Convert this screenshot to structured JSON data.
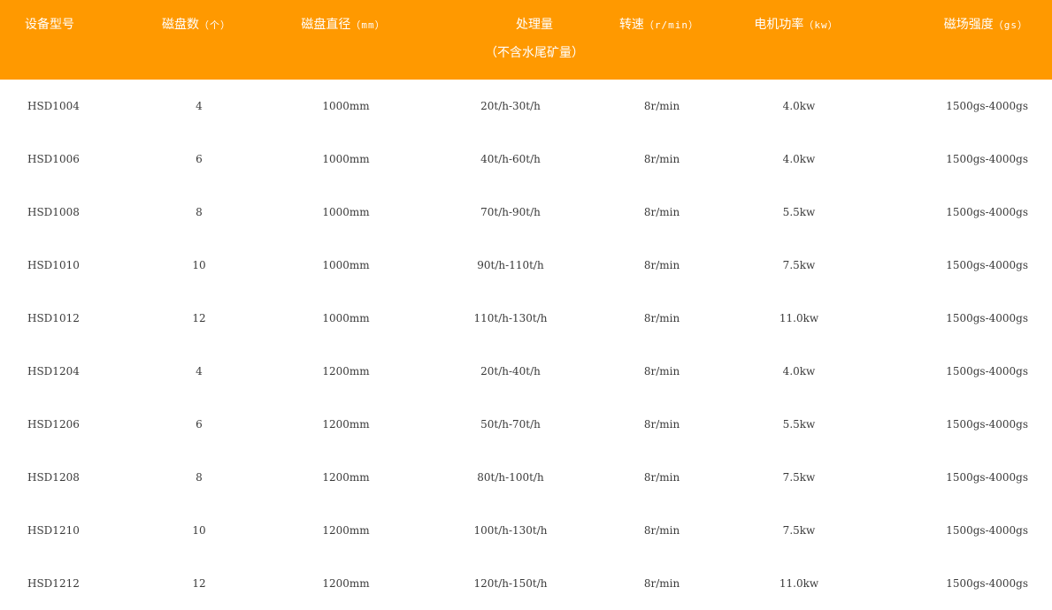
{
  "colors": {
    "header_background": "#ff9900",
    "header_text": "#ffffff",
    "body_text": "#3a3a3a",
    "page_background": "#ffffff"
  },
  "headers": {
    "model": "设备型号",
    "disc_count": "磁盘数",
    "disc_count_unit": "（个）",
    "disc_diameter": "磁盘直径",
    "disc_diameter_unit": "（mm）",
    "capacity": "处理量",
    "capacity_note": "（不含水尾矿量）",
    "speed": "转速",
    "speed_unit": "（r/min）",
    "motor_power": "电机功率",
    "motor_power_unit": "（kw）",
    "field_strength": "磁场强度",
    "field_strength_unit": "（gs）"
  },
  "rows": [
    {
      "model": "HSD1004",
      "disc_count": "4",
      "disc_diameter": "1000mm",
      "capacity": "20t/h-30t/h",
      "speed": "8r/min",
      "motor_power": "4.0kw",
      "field_strength": "1500gs-4000gs"
    },
    {
      "model": "HSD1006",
      "disc_count": "6",
      "disc_diameter": "1000mm",
      "capacity": "40t/h-60t/h",
      "speed": "8r/min",
      "motor_power": "4.0kw",
      "field_strength": "1500gs-4000gs"
    },
    {
      "model": "HSD1008",
      "disc_count": "8",
      "disc_diameter": "1000mm",
      "capacity": "70t/h-90t/h",
      "speed": "8r/min",
      "motor_power": "5.5kw",
      "field_strength": "1500gs-4000gs"
    },
    {
      "model": "HSD1010",
      "disc_count": "10",
      "disc_diameter": "1000mm",
      "capacity": "90t/h-110t/h",
      "speed": "8r/min",
      "motor_power": "7.5kw",
      "field_strength": "1500gs-4000gs"
    },
    {
      "model": "HSD1012",
      "disc_count": "12",
      "disc_diameter": "1000mm",
      "capacity": "110t/h-130t/h",
      "speed": "8r/min",
      "motor_power": "11.0kw",
      "field_strength": "1500gs-4000gs"
    },
    {
      "model": "HSD1204",
      "disc_count": "4",
      "disc_diameter": "1200mm",
      "capacity": "20t/h-40t/h",
      "speed": "8r/min",
      "motor_power": "4.0kw",
      "field_strength": "1500gs-4000gs"
    },
    {
      "model": "HSD1206",
      "disc_count": "6",
      "disc_diameter": "1200mm",
      "capacity": "50t/h-70t/h",
      "speed": "8r/min",
      "motor_power": "5.5kw",
      "field_strength": "1500gs-4000gs"
    },
    {
      "model": "HSD1208",
      "disc_count": "8",
      "disc_diameter": "1200mm",
      "capacity": "80t/h-100t/h",
      "speed": "8r/min",
      "motor_power": "7.5kw",
      "field_strength": "1500gs-4000gs"
    },
    {
      "model": "HSD1210",
      "disc_count": "10",
      "disc_diameter": "1200mm",
      "capacity": "100t/h-130t/h",
      "speed": "8r/min",
      "motor_power": "7.5kw",
      "field_strength": "1500gs-4000gs"
    },
    {
      "model": "HSD1212",
      "disc_count": "12",
      "disc_diameter": "1200mm",
      "capacity": "120t/h-150t/h",
      "speed": "8r/min",
      "motor_power": "11.0kw",
      "field_strength": "1500gs-4000gs"
    }
  ]
}
